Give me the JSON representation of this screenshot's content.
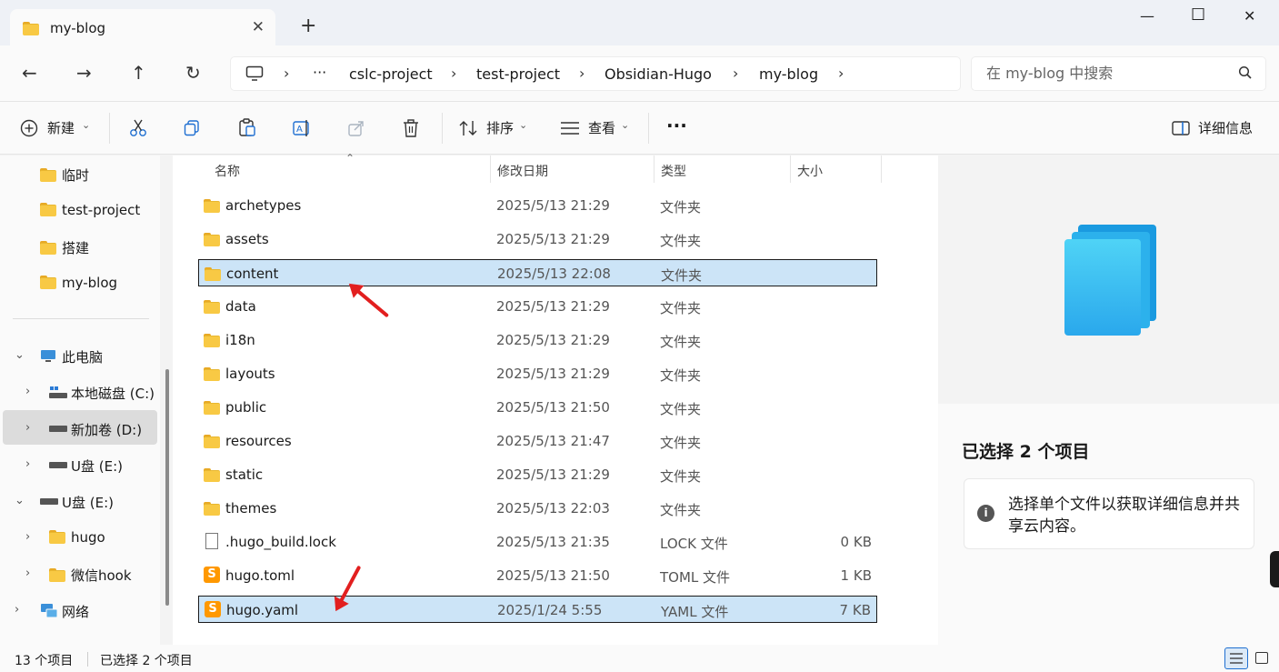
{
  "window": {
    "tab_title": "my-blog",
    "tab_close": "✕",
    "new_tab": "+",
    "minimize": "—",
    "maximize": "☐",
    "close": "✕"
  },
  "nav": {
    "back": "←",
    "forward": "→",
    "up": "↑",
    "refresh": "↻"
  },
  "breadcrumb": {
    "ellipsis": "···",
    "items": [
      "cslc-project",
      "test-project",
      "Obsidian-Hugo",
      "my-blog"
    ]
  },
  "search": {
    "placeholder": "在 my-blog 中搜索"
  },
  "toolbar": {
    "new_label": "新建",
    "sort_label": "排序",
    "view_label": "查看",
    "more_label": "···",
    "details_label": "详细信息"
  },
  "sidebar": {
    "quick_access": [
      "临时",
      "test-project",
      "搭建",
      "my-blog"
    ],
    "this_pc": "此电脑",
    "drives": [
      "本地磁盘 (C:)",
      "新加卷 (D:)",
      "U盘 (E:)"
    ],
    "usb": "U盘 (E:)",
    "usb_children": [
      "hugo",
      "微信hook"
    ],
    "network": "网络"
  },
  "columns": {
    "name": "名称",
    "date": "修改日期",
    "type": "类型",
    "size": "大小"
  },
  "files": [
    {
      "name": "archetypes",
      "date": "2025/5/13 21:29",
      "type": "文件夹",
      "size": "",
      "kind": "folder",
      "selected": false
    },
    {
      "name": "assets",
      "date": "2025/5/13 21:29",
      "type": "文件夹",
      "size": "",
      "kind": "folder",
      "selected": false
    },
    {
      "name": "content",
      "date": "2025/5/13 22:08",
      "type": "文件夹",
      "size": "",
      "kind": "folder",
      "selected": true
    },
    {
      "name": "data",
      "date": "2025/5/13 21:29",
      "type": "文件夹",
      "size": "",
      "kind": "folder",
      "selected": false
    },
    {
      "name": "i18n",
      "date": "2025/5/13 21:29",
      "type": "文件夹",
      "size": "",
      "kind": "folder",
      "selected": false
    },
    {
      "name": "layouts",
      "date": "2025/5/13 21:29",
      "type": "文件夹",
      "size": "",
      "kind": "folder",
      "selected": false
    },
    {
      "name": "public",
      "date": "2025/5/13 21:50",
      "type": "文件夹",
      "size": "",
      "kind": "folder",
      "selected": false
    },
    {
      "name": "resources",
      "date": "2025/5/13 21:47",
      "type": "文件夹",
      "size": "",
      "kind": "folder",
      "selected": false
    },
    {
      "name": "static",
      "date": "2025/5/13 21:29",
      "type": "文件夹",
      "size": "",
      "kind": "folder",
      "selected": false
    },
    {
      "name": "themes",
      "date": "2025/5/13 22:03",
      "type": "文件夹",
      "size": "",
      "kind": "folder",
      "selected": false
    },
    {
      "name": ".hugo_build.lock",
      "date": "2025/5/13 21:35",
      "type": "LOCK 文件",
      "size": "0 KB",
      "kind": "file",
      "selected": false
    },
    {
      "name": "hugo.toml",
      "date": "2025/5/13 21:50",
      "type": "TOML 文件",
      "size": "1 KB",
      "kind": "sublime",
      "selected": false
    },
    {
      "name": "hugo.yaml",
      "date": "2025/1/24 5:55",
      "type": "YAML 文件",
      "size": "7 KB",
      "kind": "sublime",
      "selected": true
    }
  ],
  "details": {
    "selection_title": "已选择 2 个项目",
    "info_text": "选择单个文件以获取详细信息并共享云内容。"
  },
  "status": {
    "count": "13 个项目",
    "selected": "已选择 2 个项目"
  }
}
